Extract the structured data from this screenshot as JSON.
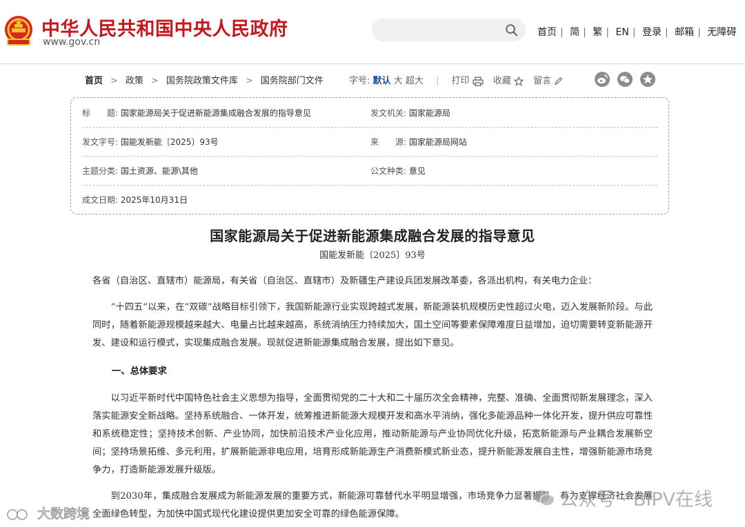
{
  "header": {
    "site_title": "中华人民共和国中央人民政府",
    "site_url": "www.gov.cn",
    "search_placeholder": "",
    "nav": [
      "首页",
      "简",
      "繁",
      "EN",
      "登录",
      "邮箱",
      "无障碍"
    ]
  },
  "breadcrumb": [
    "首页",
    "政策",
    "国务院政策文件库",
    "国务院部门文件"
  ],
  "tools": {
    "font_size_label": "字号:",
    "font_sizes": [
      "默认",
      "大",
      "超大"
    ],
    "active_font_size": "默认",
    "print": "打印",
    "favorite": "收藏",
    "comment": "留言"
  },
  "share_icons": [
    "weibo-icon",
    "wechat-icon",
    "qzone-icon"
  ],
  "info": {
    "title_label": "标　　题:",
    "title": "国家能源局关于促进新能源集成融合发展的指导意见",
    "issuer_label": "发文机关:",
    "issuer": "国家能源局",
    "doc_no_label": "发文字号:",
    "doc_no": "国能发新能〔2025〕93号",
    "source_label": "来　　源:",
    "source": "国家能源局网站",
    "category_label": "主题分类:",
    "category": "国土资源、能源\\其他",
    "doc_type_label": "公文种类:",
    "doc_type": "意见",
    "date_label": "成文日期:",
    "date": "2025年10月31日"
  },
  "article": {
    "title": "国家能源局关于促进新能源集成融合发展的指导意见",
    "number": "国能发新能〔2025〕93号",
    "addressee": "各省（自治区、直辖市）能源局，有关省（自治区、直辖市）及新疆生产建设兵团发展改革委，各派出机构，有关电力企业：",
    "p1": "“十四五”以来，在“双碳”战略目标引领下，我国新能源行业实现跨越式发展，新能源装机规模历史性超过火电，迈入发展新阶段。与此同时，随着新能源规模越来越大、电量占比越来越高，系统消纳压力持续加大，国土空间等要素保障难度日益增加，迫切需要转变新能源开发、建设和运行模式，实现集成融合发展。现就促进新能源集成融合发展，提出如下意见。",
    "section1": "一、总体要求",
    "p2": "以习近平新时代中国特色社会主义思想为指导，全面贯彻党的二十大和二十届历次全会精神，完整、准确、全面贯彻新发展理念，深入落实能源安全新战略。坚持系统融合、一体开发，统筹推进新能源大规模开发和高水平消纳，强化多能源品种一体化开发，提升供应可靠性和系统稳定性；坚持技术创新、产业协同，加快前沿技术产业化应用，推动新能源与产业协同优化升级，拓宽新能源与产业耦合发展新空间；坚持场景拓维、多元利用，扩展新能源非电应用，培育形成新能源生产消费新模式新业态，提升新能源发展自主性，增强新能源市场竞争力，打造新能源发展升级版。",
    "p3": "到2030年，集成融合发展成为新能源发展的重要方式，新能源可靠替代水平明显增强，市场竞争力显著提升，有力支撑经济社会发展全面绿色转型，为加快中国式现代化建设提供更加安全可靠的绿色能源保障。"
  },
  "watermarks": {
    "left": "大数跨境",
    "right": "公众号 · BIPV在线"
  },
  "colors": {
    "brand_red": "#c8161d",
    "emblem_gold": "#f2c230",
    "active_blue": "#1a4f9c"
  }
}
